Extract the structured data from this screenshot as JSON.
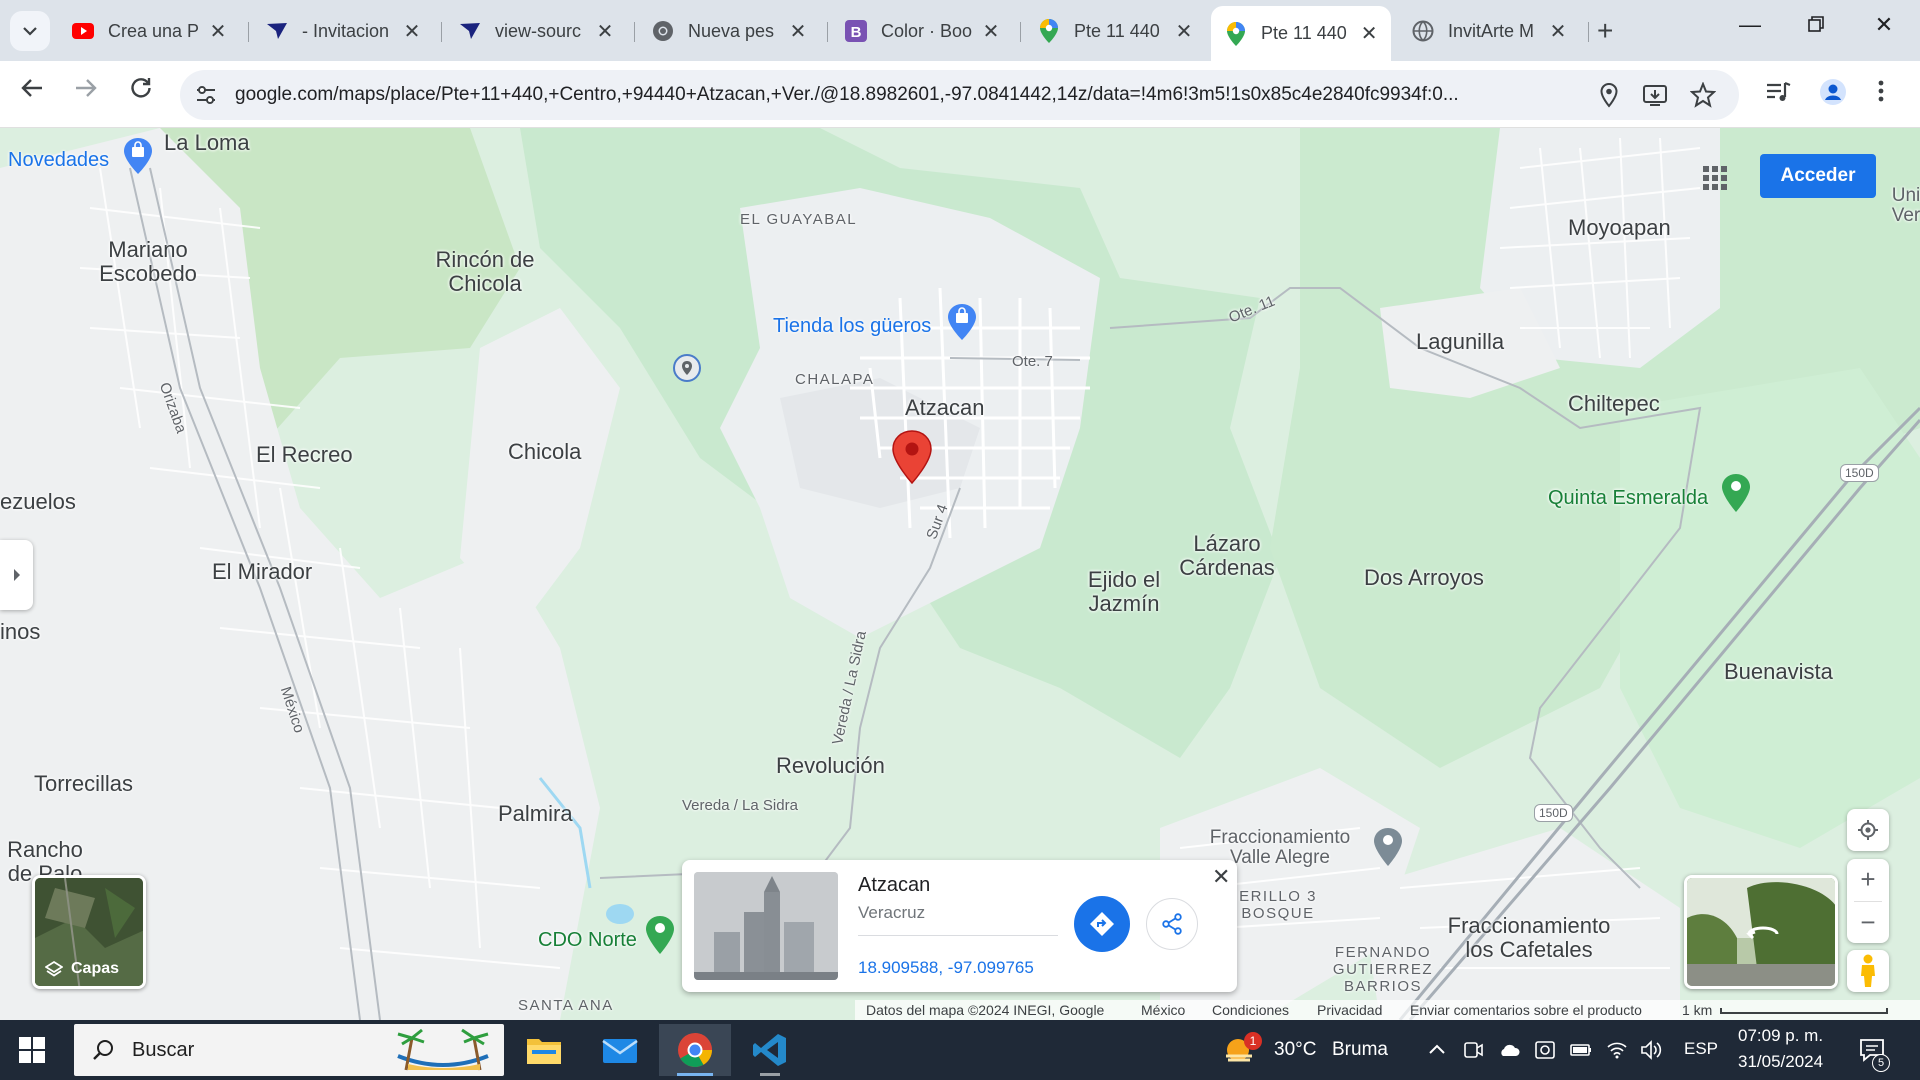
{
  "browser": {
    "tabs": [
      {
        "label": "Crea una P",
        "icon": "youtube-icon"
      },
      {
        "label": "- Invitacion",
        "icon": "tab-app-icon"
      },
      {
        "label": "view-sourc",
        "icon": "tab-app-icon"
      },
      {
        "label": "Nueva pes",
        "icon": "chrome-icon"
      },
      {
        "label": "Color · Boo",
        "icon": "bootstrap-icon"
      },
      {
        "label": "Pte 11 440",
        "icon": "maps-icon"
      },
      {
        "label": "Pte 11 440",
        "icon": "maps-icon",
        "active": true
      },
      {
        "label": "InvitArte M",
        "icon": "globe-icon"
      }
    ],
    "url": "google.com/maps/place/Pte+11+440,+Centro,+94440+Atzacan,+Ver./@18.8982601,-97.0841442,14z/data=!4m6!3m5!1s0x85c4e2840fc9934f:0..."
  },
  "map": {
    "places": [
      {
        "id": "la-loma",
        "text": "La Loma"
      },
      {
        "id": "mariano",
        "text": "Mariano Escobedo"
      },
      {
        "id": "rincon",
        "text": "Rincón de Chicola"
      },
      {
        "id": "el-guayabal",
        "text": "EL GUAYABAL"
      },
      {
        "id": "chalapa",
        "text": "CHALAPA"
      },
      {
        "id": "atzacan",
        "text": "Atzacan"
      },
      {
        "id": "chicola",
        "text": "Chicola"
      },
      {
        "id": "el-recreo",
        "text": "El Recreo"
      },
      {
        "id": "zuelos",
        "text": "ezuelos"
      },
      {
        "id": "el-mirador",
        "text": "El Mirador"
      },
      {
        "id": "inos",
        "text": "inos"
      },
      {
        "id": "torrecillas",
        "text": "Torrecillas"
      },
      {
        "id": "rancho",
        "text": "Rancho de Palo"
      },
      {
        "id": "palmira",
        "text": "Palmira"
      },
      {
        "id": "revolucion",
        "text": "Revolución"
      },
      {
        "id": "ejido",
        "text": "Ejido el Jazmín"
      },
      {
        "id": "lazaro",
        "text": "Lázaro Cárdenas"
      },
      {
        "id": "dos-arroyos",
        "text": "Dos Arroyos"
      },
      {
        "id": "moyoapan",
        "text": "Moyoapan"
      },
      {
        "id": "lagunilla",
        "text": "Lagunilla"
      },
      {
        "id": "chiltepec",
        "text": "Chiltepec"
      },
      {
        "id": "buenavista",
        "text": "Buenavista"
      },
      {
        "id": "fracc-cafetales",
        "text": "Fraccionamiento los Cafetales"
      },
      {
        "id": "santa-ana",
        "text": "SANTA ANA"
      },
      {
        "id": "cerillo",
        "text": "ERILLO 3 BOSQUE"
      },
      {
        "id": "fernando",
        "text": "FERNANDO GUTIERREZ BARRIOS"
      },
      {
        "id": "uni",
        "text": "Uni Ver"
      }
    ],
    "pois": [
      {
        "id": "novedades",
        "text": "Novedades"
      },
      {
        "id": "tienda",
        "text": "Tienda los güeros"
      },
      {
        "id": "quinta",
        "text": "Quinta Esmeralda"
      },
      {
        "id": "cdo",
        "text": "CDO Norte"
      },
      {
        "id": "valle-alegre",
        "text": "Fraccionamiento Valle Alegre"
      }
    ],
    "roads": [
      {
        "id": "orizaba",
        "text": "Orizaba"
      },
      {
        "id": "mexico",
        "text": "México"
      },
      {
        "id": "ote7",
        "text": "Ote. 7"
      },
      {
        "id": "ote11",
        "text": "Ote. 11"
      },
      {
        "id": "sur4",
        "text": "Sur 4"
      },
      {
        "id": "vereda1",
        "text": "Vereda / La Sidra"
      },
      {
        "id": "vereda2",
        "text": "Vereda / La Sidra"
      },
      {
        "id": "hw150-1",
        "text": "150D"
      },
      {
        "id": "hw150-2",
        "text": "150D"
      }
    ],
    "acceder": "Acceder",
    "layers_label": "Capas",
    "card": {
      "title": "Atzacan",
      "subtitle": "Veracruz",
      "coords": "18.909588, -97.099765"
    },
    "attribution": {
      "data": "Datos del mapa ©2024 INEGI, Google",
      "country": "México",
      "terms": "Condiciones",
      "privacy": "Privacidad",
      "feedback": "Enviar comentarios sobre el producto",
      "scale": "1 km"
    }
  },
  "taskbar": {
    "search_placeholder": "Buscar",
    "weather_temp": "30°C",
    "weather_desc": "Bruma",
    "weather_badge": "1",
    "lang": "ESP",
    "time": "07:09 p. m.",
    "date": "31/05/2024",
    "notif_count": "5"
  }
}
